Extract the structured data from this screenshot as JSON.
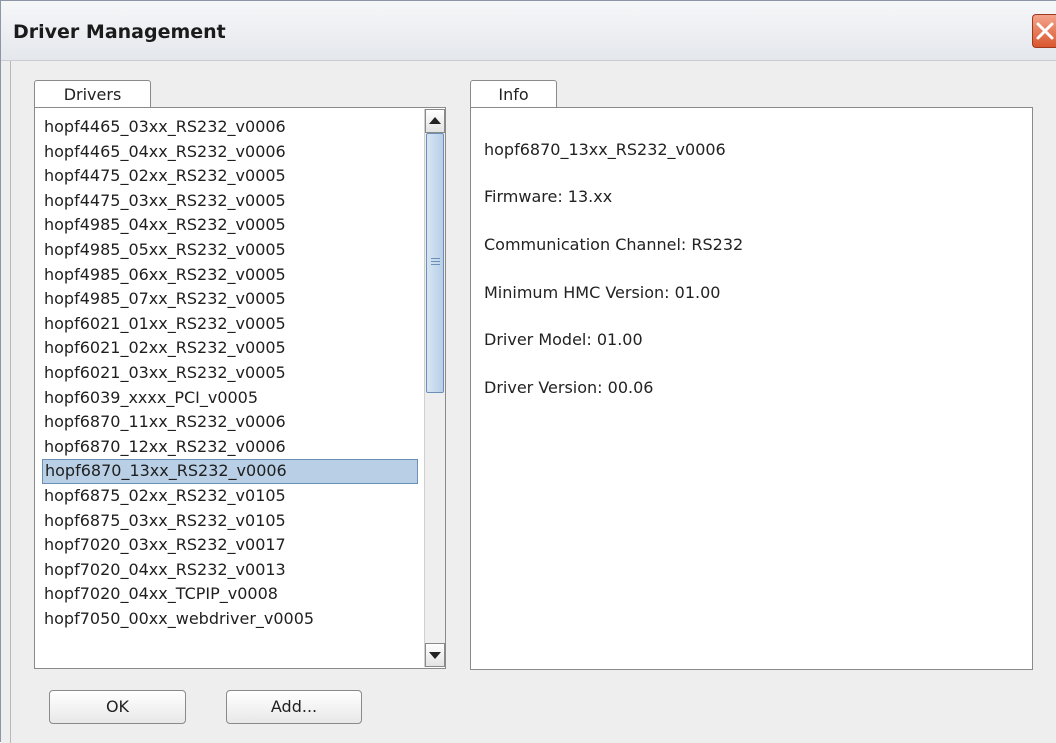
{
  "window": {
    "title": "Driver Management"
  },
  "tabs": {
    "drivers": "Drivers",
    "info": "Info"
  },
  "drivers": {
    "items": [
      "hopf4465_03xx_RS232_v0006",
      "hopf4465_04xx_RS232_v0006",
      "hopf4475_02xx_RS232_v0005",
      "hopf4475_03xx_RS232_v0005",
      "hopf4985_04xx_RS232_v0005",
      "hopf4985_05xx_RS232_v0005",
      "hopf4985_06xx_RS232_v0005",
      "hopf4985_07xx_RS232_v0005",
      "hopf6021_01xx_RS232_v0005",
      "hopf6021_02xx_RS232_v0005",
      "hopf6021_03xx_RS232_v0005",
      "hopf6039_xxxx_PCI_v0005",
      "hopf6870_11xx_RS232_v0006",
      "hopf6870_12xx_RS232_v0006",
      "hopf6870_13xx_RS232_v0006",
      "hopf6875_02xx_RS232_v0105",
      "hopf6875_03xx_RS232_v0105",
      "hopf7020_03xx_RS232_v0017",
      "hopf7020_04xx_RS232_v0013",
      "hopf7020_04xx_TCPIP_v0008",
      "hopf7050_00xx_webdriver_v0005"
    ],
    "selected_index": 14
  },
  "info": {
    "name": "hopf6870_13xx_RS232_v0006",
    "firmware": "Firmware: 13.xx",
    "channel": "Communication Channel: RS232",
    "min_hmc": "Minimum HMC Version: 01.00",
    "model": "Driver Model: 01.00",
    "version": "Driver Version: 00.06"
  },
  "buttons": {
    "ok": "OK",
    "add": "Add..."
  },
  "colors": {
    "selection": "#b8cfe5",
    "close": "#d9572f"
  }
}
